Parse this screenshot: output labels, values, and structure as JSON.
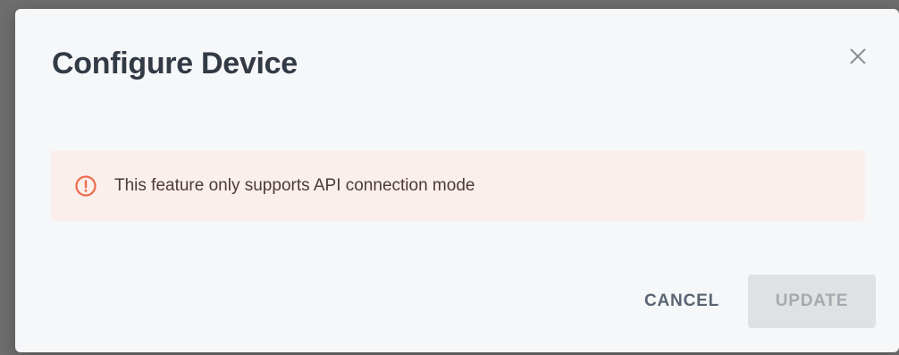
{
  "dialog": {
    "title": "Configure Device",
    "close_icon": "close-icon",
    "alert": {
      "icon": "alert-circle-icon",
      "message": "This feature only supports API connection mode",
      "accent_color": "#ef6b4d",
      "background_color": "#fbefec"
    },
    "actions": {
      "cancel_label": "CANCEL",
      "update_label": "UPDATE",
      "update_disabled": true
    }
  }
}
